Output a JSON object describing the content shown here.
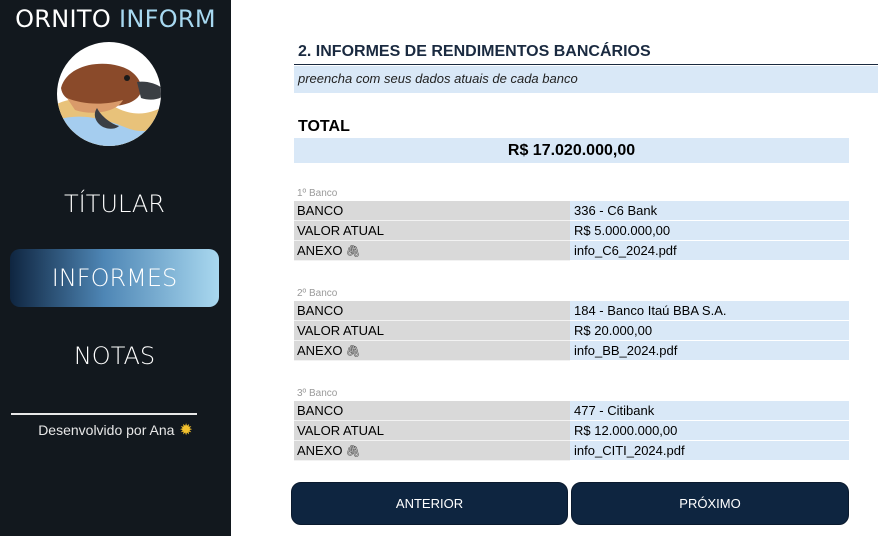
{
  "brand": {
    "word1": "ORNITO",
    "word2": "INFORM"
  },
  "logo": {
    "icon": "platypus-icon"
  },
  "nav": {
    "titular": "TÍTULAR",
    "informes": "INFORMES",
    "notas": "NOTAS",
    "active": "informes"
  },
  "footer": {
    "text": "Desenvolvido por Ana",
    "icon": "sun-icon"
  },
  "section": {
    "title": "2. INFORMES DE RENDIMENTOS BANCÁRIOS",
    "subtitle": "preencha com seus dados atuais de cada banco"
  },
  "total": {
    "label": "TOTAL",
    "value": "R$ 17.020.000,00"
  },
  "banks": [
    {
      "caption": "1º Banco",
      "rows": [
        {
          "key": "BANCO",
          "value": "336 - C6 Bank"
        },
        {
          "key": "VALOR ATUAL",
          "value": "R$ 5.000.000,00"
        },
        {
          "key": "ANEXO",
          "value": "info_C6_2024.pdf"
        }
      ]
    },
    {
      "caption": "2º Banco",
      "rows": [
        {
          "key": "BANCO",
          "value": "184 - Banco Itaú BBA S.A."
        },
        {
          "key": "VALOR ATUAL",
          "value": "R$ 20.000,00"
        },
        {
          "key": "ANEXO",
          "value": "info_BB_2024.pdf"
        }
      ]
    },
    {
      "caption": "3º Banco",
      "rows": [
        {
          "key": "BANCO",
          "value": "477 - Citibank"
        },
        {
          "key": "VALOR ATUAL",
          "value": "R$ 12.000.000,00"
        },
        {
          "key": "ANEXO",
          "value": "info_CITI_2024.pdf"
        }
      ]
    }
  ],
  "buttons": {
    "prev": "ANTERIOR",
    "next": "PRÓXIMO"
  },
  "colors": {
    "sidebar": "#12181e",
    "accent": "#a7d8f0",
    "button": "#0e2540",
    "field": "#d9e8f7",
    "label": "#d9d9d9"
  }
}
